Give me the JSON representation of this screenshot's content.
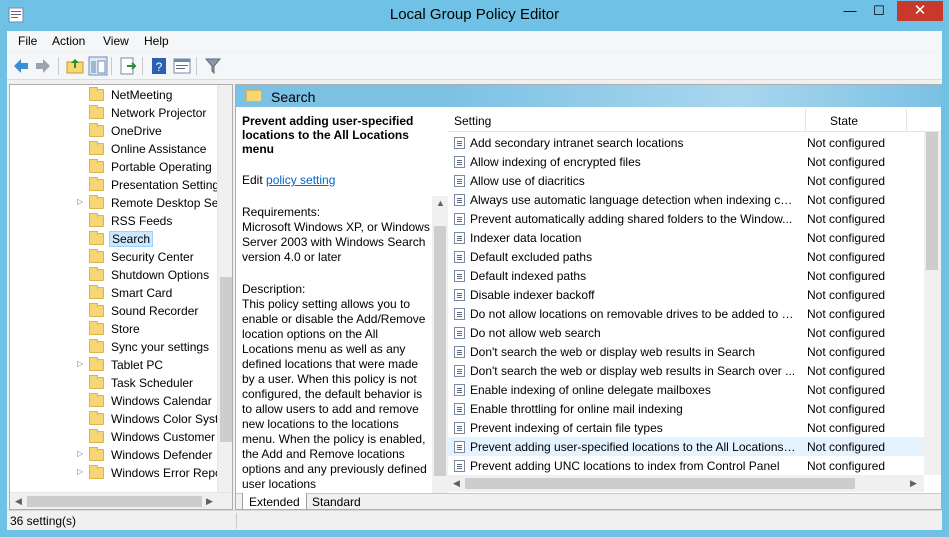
{
  "window": {
    "title": "Local Group Policy Editor",
    "minimize": "—",
    "maximize": "☐",
    "close": "✕"
  },
  "menu": [
    "File",
    "Action",
    "View",
    "Help"
  ],
  "toolbar": {
    "icons": [
      "back-icon",
      "forward-icon",
      "up-folder-icon",
      "show-hide-tree-icon",
      "export-list-icon",
      "help-icon",
      "properties-icon",
      "filter-icon"
    ]
  },
  "tree": {
    "items": [
      {
        "label": "NetMeeting",
        "expandable": false
      },
      {
        "label": "Network Projector",
        "expandable": false
      },
      {
        "label": "OneDrive",
        "expandable": false
      },
      {
        "label": "Online Assistance",
        "expandable": false
      },
      {
        "label": "Portable Operating",
        "expandable": false
      },
      {
        "label": "Presentation Setting",
        "expandable": false
      },
      {
        "label": "Remote Desktop Se",
        "expandable": true
      },
      {
        "label": "RSS Feeds",
        "expandable": false
      },
      {
        "label": "Search",
        "expandable": false,
        "selected": true
      },
      {
        "label": "Security Center",
        "expandable": false
      },
      {
        "label": "Shutdown Options",
        "expandable": false
      },
      {
        "label": "Smart Card",
        "expandable": false
      },
      {
        "label": "Sound Recorder",
        "expandable": false
      },
      {
        "label": "Store",
        "expandable": false
      },
      {
        "label": "Sync your settings",
        "expandable": false
      },
      {
        "label": "Tablet PC",
        "expandable": true
      },
      {
        "label": "Task Scheduler",
        "expandable": false
      },
      {
        "label": "Windows Calendar",
        "expandable": false
      },
      {
        "label": "Windows Color Syst",
        "expandable": false
      },
      {
        "label": "Windows Customer",
        "expandable": false
      },
      {
        "label": "Windows Defender",
        "expandable": true
      },
      {
        "label": "Windows Error Repo",
        "expandable": true
      }
    ]
  },
  "header": {
    "title": "Search"
  },
  "description": {
    "title": "Prevent adding user-specified locations to the All Locations menu",
    "edit_prefix": "Edit ",
    "edit_link": "policy setting ",
    "requirements": "Requirements:\nMicrosoft Windows XP, or Windows Server 2003 with Windows Search version 4.0 or later",
    "description": "Description:\nThis policy setting allows you to enable or disable the Add/Remove location options on the All Locations menu as well as any defined locations that were made by a user.  When this policy is not configured, the default behavior is to allow users to add and remove new locations to the locations menu.  When the policy is enabled, the Add and Remove locations options and any previously defined user locations"
  },
  "tabs": {
    "extended": "Extended",
    "standard": "Standard"
  },
  "list": {
    "columns": {
      "setting": "Setting",
      "state": "State"
    },
    "rows": [
      {
        "setting": "Add secondary intranet search locations",
        "state": "Not configured"
      },
      {
        "setting": "Allow indexing of encrypted files",
        "state": "Not configured"
      },
      {
        "setting": "Allow use of diacritics",
        "state": "Not configured"
      },
      {
        "setting": "Always use automatic language detection when indexing co...",
        "state": "Not configured"
      },
      {
        "setting": "Prevent automatically adding shared folders to the Window...",
        "state": "Not configured"
      },
      {
        "setting": "Indexer data location",
        "state": "Not configured"
      },
      {
        "setting": "Default excluded paths",
        "state": "Not configured"
      },
      {
        "setting": "Default indexed paths",
        "state": "Not configured"
      },
      {
        "setting": "Disable indexer backoff",
        "state": "Not configured"
      },
      {
        "setting": "Do not allow locations on removable drives to be added to li...",
        "state": "Not configured"
      },
      {
        "setting": "Do not allow web search",
        "state": "Not configured"
      },
      {
        "setting": "Don't search the web or display web results in Search",
        "state": "Not configured"
      },
      {
        "setting": "Don't search the web or display web results in Search over ...",
        "state": "Not configured"
      },
      {
        "setting": "Enable indexing of online delegate mailboxes",
        "state": "Not configured"
      },
      {
        "setting": "Enable throttling for online mail indexing",
        "state": "Not configured"
      },
      {
        "setting": "Prevent indexing of certain file types",
        "state": "Not configured"
      },
      {
        "setting": "Prevent adding user-specified locations to the All Locations ...",
        "state": "Not configured",
        "selected": true
      },
      {
        "setting": "Prevent adding UNC locations to index from Control Panel",
        "state": "Not configured"
      }
    ]
  },
  "status": {
    "text": "36 setting(s)"
  }
}
